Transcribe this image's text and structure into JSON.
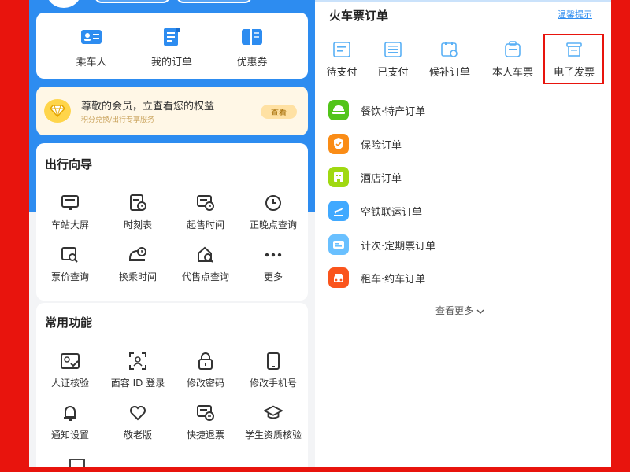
{
  "quick_menu": [
    {
      "label": "乘车人",
      "icon": "passenger-card-icon"
    },
    {
      "label": "我的订单",
      "icon": "order-doc-icon"
    },
    {
      "label": "优惠券",
      "icon": "coupon-icon"
    }
  ],
  "vip": {
    "title": "尊敬的会员，立查看您的权益",
    "subtitle": "积分兑换/出行专享服务",
    "button": "查看"
  },
  "travel_guide": {
    "title": "出行向导",
    "items": [
      {
        "label": "车站大屏",
        "icon": "station-screen-icon"
      },
      {
        "label": "时刻表",
        "icon": "timetable-icon"
      },
      {
        "label": "起售时间",
        "icon": "sale-time-icon"
      },
      {
        "label": "正晚点查询",
        "icon": "clock-icon"
      },
      {
        "label": "票价查询",
        "icon": "fare-query-icon"
      },
      {
        "label": "换乘时间",
        "icon": "transfer-time-icon"
      },
      {
        "label": "代售点查询",
        "icon": "agency-query-icon"
      },
      {
        "label": "更多",
        "icon": "more-dots-icon"
      }
    ]
  },
  "common_functions": {
    "title": "常用功能",
    "items": [
      {
        "label": "人证核验",
        "icon": "id-verify-icon"
      },
      {
        "label": "面容 ID 登录",
        "icon": "face-id-icon"
      },
      {
        "label": "修改密码",
        "icon": "lock-icon"
      },
      {
        "label": "修改手机号",
        "icon": "phone-icon"
      },
      {
        "label": "通知设置",
        "icon": "bell-icon"
      },
      {
        "label": "敬老版",
        "icon": "heart-icon"
      },
      {
        "label": "快捷退票",
        "icon": "quick-refund-icon"
      },
      {
        "label": "学生资质核验",
        "icon": "graduation-cap-icon"
      }
    ]
  },
  "train_orders": {
    "title": "火车票订单",
    "tip": "温馨提示",
    "statuses": [
      {
        "label": "待支付",
        "icon": "pending-pay-icon"
      },
      {
        "label": "已支付",
        "icon": "paid-icon"
      },
      {
        "label": "候补订单",
        "icon": "waitlist-icon"
      },
      {
        "label": "本人车票",
        "icon": "my-ticket-icon"
      },
      {
        "label": "电子发票",
        "icon": "e-invoice-icon"
      }
    ]
  },
  "other_orders": [
    {
      "label": "餐饮·特产订单",
      "icon": "food-icon",
      "color": "#52c41a"
    },
    {
      "label": "保险订单",
      "icon": "insurance-icon",
      "color": "#fa8c16"
    },
    {
      "label": "酒店订单",
      "icon": "hotel-icon",
      "color": "#a0d911"
    },
    {
      "label": "空铁联运订单",
      "icon": "air-rail-icon",
      "color": "#40a9ff"
    },
    {
      "label": "计次·定期票订单",
      "icon": "pass-ticket-icon",
      "color": "#69c0ff"
    },
    {
      "label": "租车·约车订单",
      "icon": "car-rental-icon",
      "color": "#fa541c"
    }
  ],
  "see_more": "查看更多",
  "colors": {
    "frame_red": "#e8140d",
    "primary_blue": "#2d8cf0",
    "vip_gold": "#ffd54a"
  }
}
